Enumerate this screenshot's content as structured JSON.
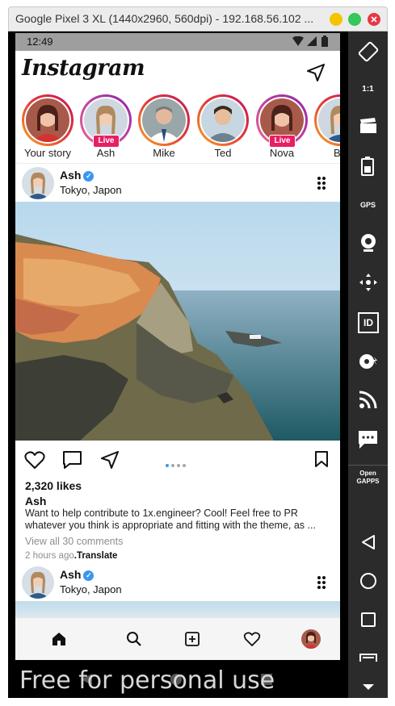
{
  "window": {
    "title": "Google Pixel 3 XL (1440x2960, 560dpi) - 192.168.56.102 ...",
    "colors": {
      "minimize": "#f5c400",
      "maximize": "#34c759",
      "close": "#e53945"
    }
  },
  "status_bar": {
    "time": "12:49",
    "icons": [
      "wifi-icon",
      "signal-icon",
      "battery-icon"
    ]
  },
  "app": {
    "logo": "Instagram",
    "stories": [
      {
        "label": "Your story",
        "live": false
      },
      {
        "label": "Ash",
        "live": true,
        "badge": "Live"
      },
      {
        "label": "Mike",
        "live": false
      },
      {
        "label": "Ted",
        "live": false
      },
      {
        "label": "Nova",
        "live": true,
        "badge": "Live"
      },
      {
        "label": "Ba",
        "live": false
      }
    ],
    "post": {
      "username": "Ash",
      "location": "Tokyo, Japon",
      "likes": "2,320 likes",
      "caption_user": "Ash",
      "caption_text": "Want to help contribute to 1x.engineer? Cool! Feel free to PR whatever you think is appropriate and fitting with the theme, as ...",
      "view_comments": "View all 30 comments",
      "time_ago": "2 hours ago",
      "translate": ".Translate",
      "carousel_pages": 4,
      "carousel_active": 1
    },
    "next_post": {
      "username": "Ash",
      "location": "Tokyo, Japon"
    },
    "bottom_nav": [
      "home-icon",
      "search-icon",
      "add-icon",
      "heart-icon",
      "profile-avatar"
    ]
  },
  "emulator_toolbar": [
    "rotate-icon",
    "scale-1-1-icon",
    "screen-record-icon",
    "battery-icon",
    "gps-icon",
    "camera-icon",
    "move-icon",
    "identity-icon",
    "disk-icon",
    "cast-icon",
    "message-icon",
    "opengapps-icon",
    "back-icon",
    "home-circle-icon",
    "recents-icon",
    "menu-icon"
  ],
  "toolbar_labels": {
    "scale": "1:1",
    "gps": "GPS",
    "id": "ID",
    "open_gapps": "Open\nGAPPS"
  },
  "watermark": "Free for personal use"
}
